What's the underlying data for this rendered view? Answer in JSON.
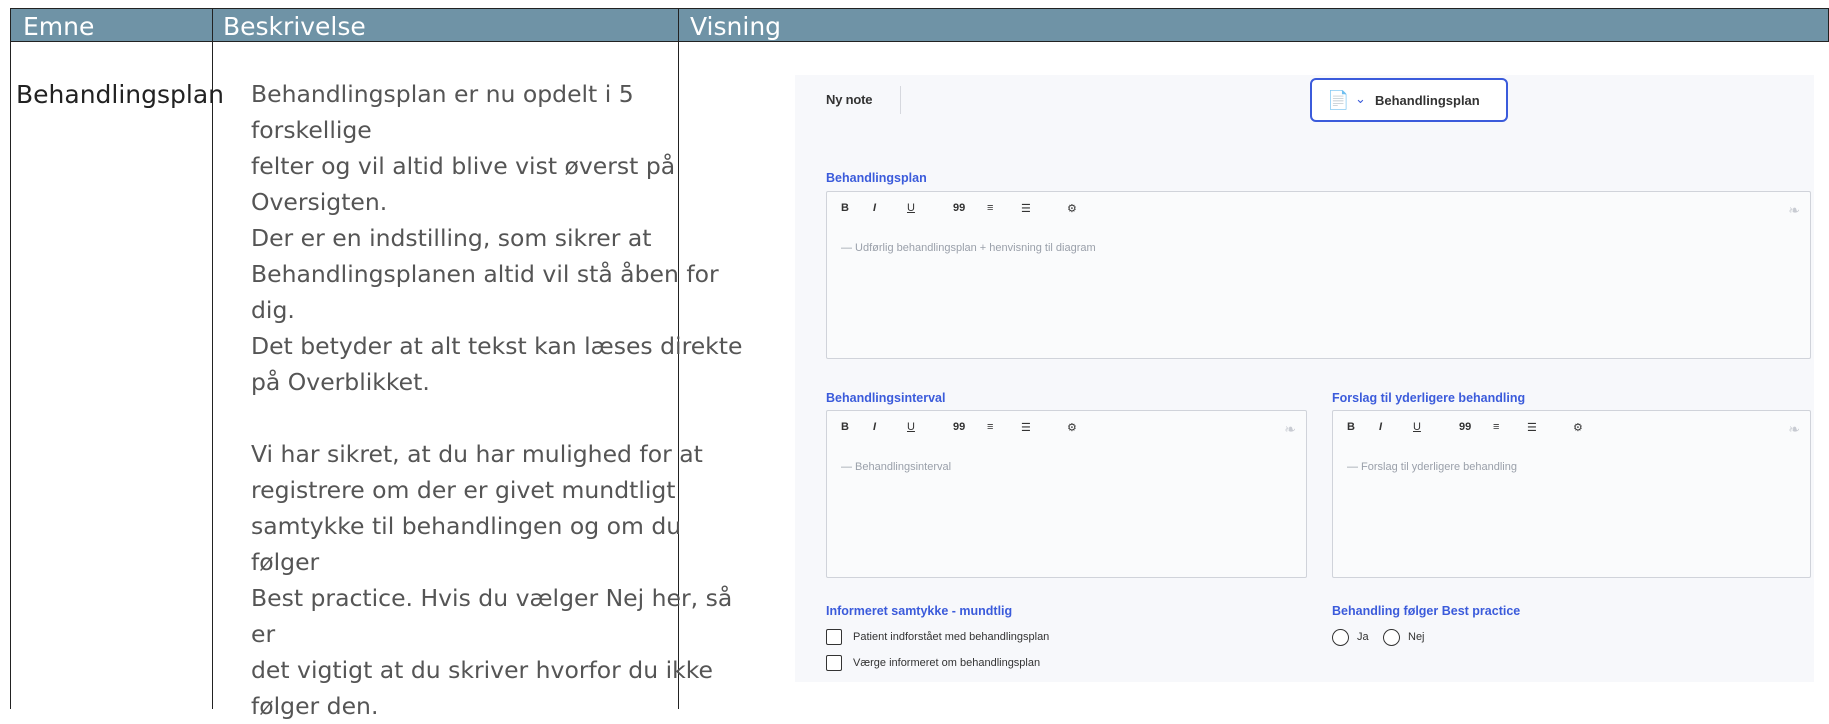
{
  "table": {
    "headers": [
      "Emne",
      "Beskrivelse",
      "Visning"
    ],
    "topic": "Behandlingsplan",
    "description_lines_1": [
      "Behandlingsplan er nu opdelt i 5 forskellige",
      "felter og vil altid blive vist øverst på",
      "Oversigten.",
      "Der er en indstilling, som sikrer at",
      "Behandlingsplanen altid vil stå åben for dig.",
      "Det betyder at alt tekst kan læses direkte",
      "på Overblikket."
    ],
    "description_lines_2": [
      "Vi har sikret, at du har mulighed for at",
      "registrere om der er givet mundtligt",
      "samtykke til behandlingen og om du følger",
      "Best practice. Hvis du vælger Nej her, så er",
      "det vigtigt at du skriver hvorfor du ikke",
      "følger den."
    ]
  },
  "screenshot": {
    "note_label": "Ny note",
    "dropdown_label": "Behandlingsplan",
    "toolbar": [
      "B",
      "I",
      "U",
      "99",
      "≡",
      "☰",
      "⚙"
    ],
    "field1": {
      "label": "Behandlingsplan",
      "placeholder": "— Udførlig behandlingsplan + henvisning til diagram"
    },
    "field2": {
      "label": "Behandlingsinterval",
      "placeholder": "— Behandlingsinterval"
    },
    "field3": {
      "label": "Forslag til yderligere behandling",
      "placeholder": "— Forslag til yderligere behandling"
    },
    "consent": {
      "label": "Informeret samtykke - mundtlig",
      "options": [
        "Patient indforstået med behandlingsplan",
        "Værge informeret om behandlingsplan"
      ]
    },
    "best_practice": {
      "label": "Behandling følger Best practice",
      "options": [
        "Ja",
        "Nej"
      ]
    }
  }
}
